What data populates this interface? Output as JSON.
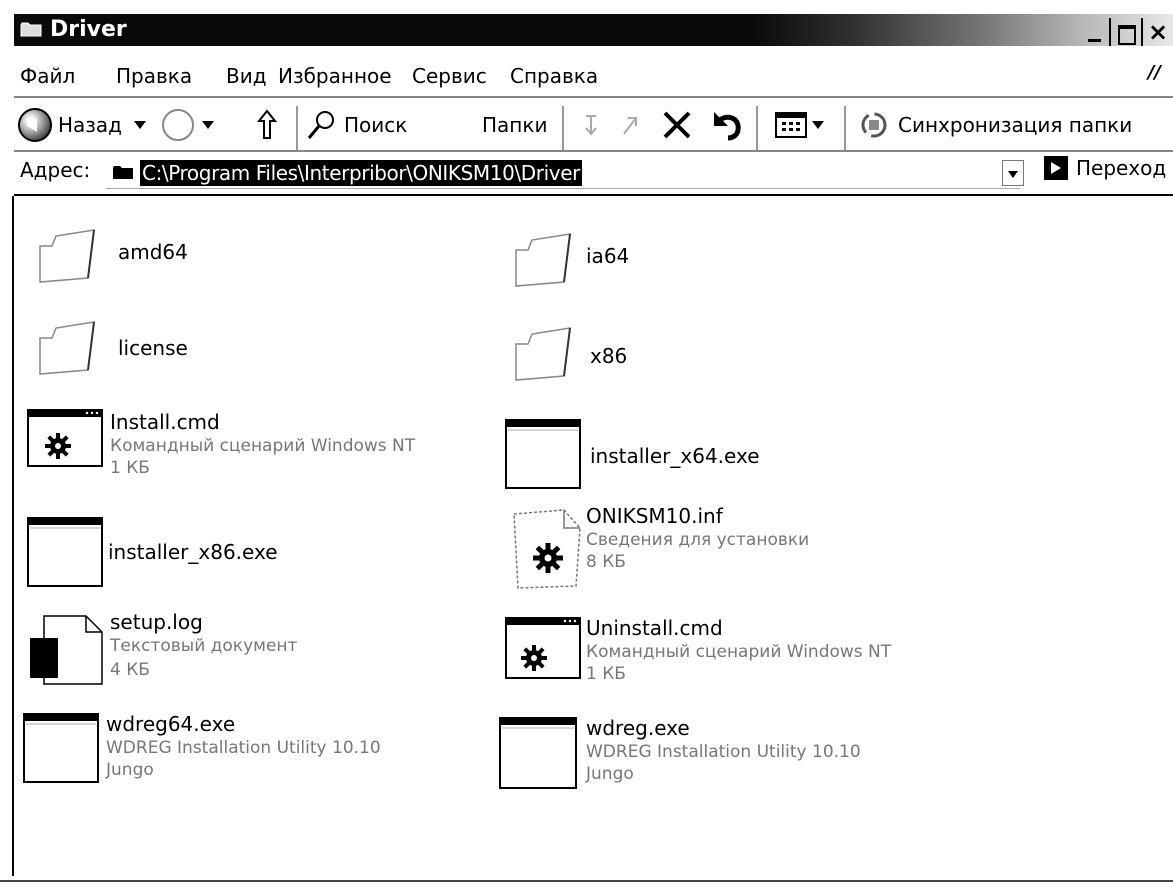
{
  "window": {
    "title": "Driver"
  },
  "menu": [
    "Файл",
    "Правка",
    "Вид",
    "Избранное",
    "Сервис",
    "Справка"
  ],
  "toolbar": {
    "back_label": "Назад",
    "search_label": "Поиск",
    "folders_label": "Папки",
    "sync_label": "Синхронизация папки"
  },
  "address": {
    "label": "Адрес:",
    "value": "C:\\Program Files\\Interpribor\\ONIKSM10\\Driver",
    "go_label": "Переход"
  },
  "files": [
    {
      "name": "amd64",
      "icon": "folder-icon",
      "details": []
    },
    {
      "name": "ia64",
      "icon": "folder-icon",
      "details": []
    },
    {
      "name": "license",
      "icon": "folder-icon",
      "details": []
    },
    {
      "name": "x86",
      "icon": "folder-icon",
      "details": []
    },
    {
      "name": "Install.cmd",
      "icon": "script-icon",
      "details": [
        "Командный сценарий Windows NT",
        "1 КБ"
      ]
    },
    {
      "name": "installer_x64.exe",
      "icon": "exe-icon",
      "details": []
    },
    {
      "name": "installer_x86.exe",
      "icon": "exe-icon",
      "details": []
    },
    {
      "name": "ONIKSM10.inf",
      "icon": "inf-icon",
      "details": [
        "Сведения для установки",
        "8 КБ"
      ]
    },
    {
      "name": "setup.log",
      "icon": "text-document-icon",
      "details": [
        "Текстовый документ",
        "4 КБ"
      ]
    },
    {
      "name": "Uninstall.cmd",
      "icon": "script-icon",
      "details": [
        "Командный сценарий Windows NT",
        "1 КБ"
      ]
    },
    {
      "name": "wdreg64.exe",
      "icon": "exe-icon",
      "details": [
        "WDREG Installation Utility 10.10",
        "Jungo"
      ]
    },
    {
      "name": "wdreg.exe",
      "icon": "exe-icon",
      "details": [
        "WDREG Installation Utility 10.10",
        "Jungo"
      ]
    }
  ]
}
